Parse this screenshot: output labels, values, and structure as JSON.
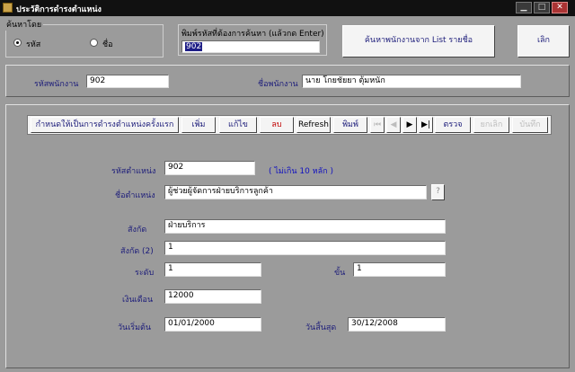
{
  "window": {
    "title": "ประวัติการดำรงตำแหน่ง",
    "buttons": [
      "▁",
      "□",
      "✕"
    ]
  },
  "search": {
    "group_label": "ค้นหาโดย",
    "options": [
      "รหัส",
      "ชื่อ"
    ],
    "selected": "รหัส",
    "input_label": "พิมพ์รหัสที่ต้องการค้นหา (แล้วกด Enter)",
    "input_value": "902",
    "list_button": "ค้นหาพนักงานจาก List รายชื่อ",
    "exit_button": "เลิก"
  },
  "employee": {
    "code_label": "รหัสพนักงาน",
    "code_value": "902",
    "name_label": "ชื่อพนักงาน",
    "name_value": "นาย โกยชัยยา ตุ้มหนัก"
  },
  "toolbar": {
    "first_position": "กำหนดให้เป็นการดำรงตำแหน่งครั้งแรก",
    "add": "เพิ่ม",
    "edit": "แก้ไข",
    "delete": "ลบ",
    "refresh": "Refresh",
    "print": "พิมพ์",
    "nav_first": "⏮",
    "nav_prev": "◀",
    "nav_next": "▶",
    "nav_last": "▶|",
    "check": "ตรวจ",
    "cancel": "ยกเลิก",
    "save": "บันทึก"
  },
  "form": {
    "position_code_label": "รหัสตำแหน่ง",
    "position_code_value": "902",
    "position_code_hint": "( ไม่เกิน 10 หลัก )",
    "position_name_label": "ชื่อตำแหน่ง",
    "position_name_value": "ผู้ช่วยผู้จัดการฝ่ายบริการลูกค้า",
    "lookup_button": "?",
    "dept_label": "สังกัด",
    "dept_value": "ฝ่ายบริการ",
    "dept2_label": "สังกัด (2)",
    "dept2_value": "1",
    "level_label": "ระดับ",
    "level_value": "1",
    "grade_label": "ขั้น",
    "grade_value": "1",
    "salary_label": "เงินเดือน",
    "salary_value": "12000",
    "start_label": "วันเริ่มต้น",
    "start_value": "01/01/2000",
    "end_label": "วันสิ้นสุด",
    "end_value": "30/12/2008"
  }
}
